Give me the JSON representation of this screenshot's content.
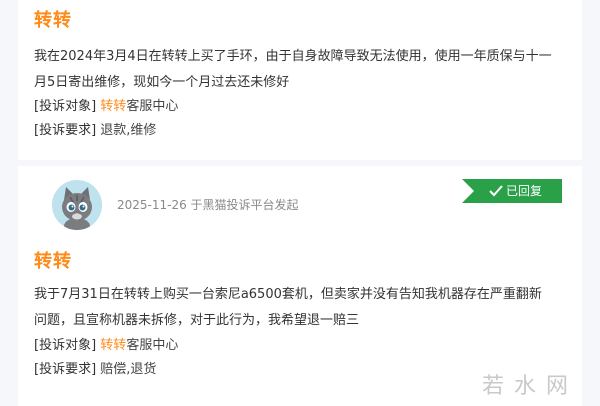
{
  "complaints": [
    {
      "title": "转转",
      "content": "我在2024年3月4日在转转上买了手环，由于自身故障导致无法使用，使用一年质保与十一月5日寄出维修，现如今一个月过去还未修好",
      "target_label": "[投诉对象]",
      "target_highlight": "转转",
      "target_rest": "客服中心",
      "demand_label": "[投诉要求]",
      "demand_value": "退款,维修"
    },
    {
      "title": "转转",
      "content": "我于7月31日在转转上购买一台索尼a6500套机，但卖家并没有告知我机器存在严重翻新问题，且宣称机器未拆修，对于此行为，我希望退一赔三",
      "target_label": "[投诉对象]",
      "target_highlight": "转转",
      "target_rest": "客服中心",
      "demand_label": "[投诉要求]",
      "demand_value": "赔偿,退货"
    }
  ],
  "post": {
    "meta": "2025-11-26  于黑猫投诉平台发起",
    "status_badge": "已回复",
    "status_color": "#2aa149"
  },
  "watermark": "若水网",
  "icons": {
    "avatar": "gray-cat-avatar",
    "check": "check-icon"
  }
}
